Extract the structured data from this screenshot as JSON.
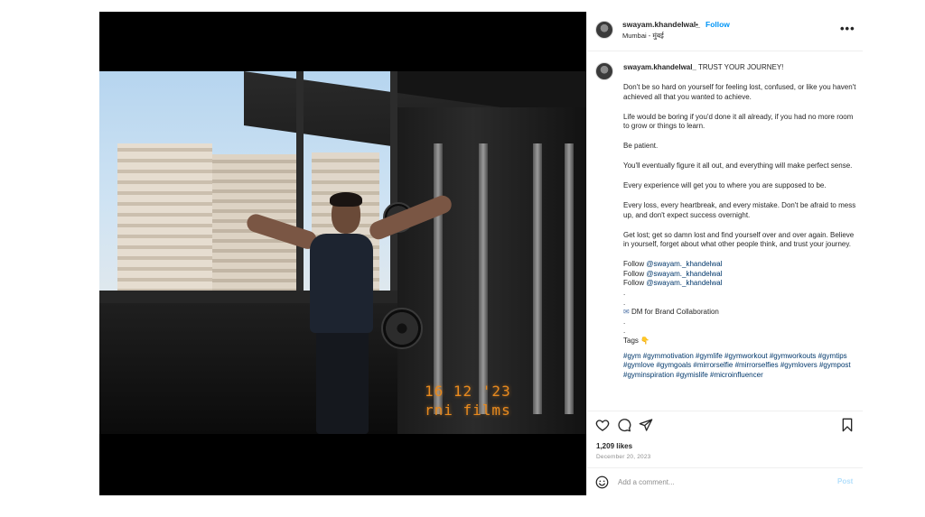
{
  "post": {
    "username": "swayam.khandelwal_",
    "separator": "•",
    "follow_label": "Follow",
    "location": "Mumbai - मुंबई",
    "more_label": "•••",
    "photo_stamp": {
      "line1": "16 12 '23",
      "line2": "rni films"
    }
  },
  "caption": {
    "username": "swayam.khandelwal_",
    "headline": "TRUST YOUR JOURNEY!",
    "paragraphs": [
      "Don't be so hard on yourself for feeling lost, confused, or like you haven't achieved all that you wanted to achieve.",
      "Life would be boring if you'd done it all already, if you had no more room to grow or things to learn.",
      "Be patient.",
      "You'll eventually figure it all out, and everything will make perfect sense.",
      "Every experience will get you to where you are supposed to be.",
      "Every loss, every heartbreak, and every mistake. Don't be afraid to mess up, and don't expect success overnight.",
      "Get lost; get so damn lost and find yourself over and over again. Believe in yourself, forget about what other people think, and trust your journey."
    ],
    "follow_lines": [
      {
        "prefix": "Follow ",
        "mention": "@swayam._khandelwal"
      },
      {
        "prefix": "Follow ",
        "mention": "@swayam._khandelwal"
      },
      {
        "prefix": "Follow ",
        "mention": "@swayam._khandelwal"
      }
    ],
    "dot": ".",
    "dm_line": "DM for Brand Collaboration",
    "dm_icon": "✉",
    "tags_label": "Tags 👇",
    "hashtags": "#gym #gymmotivation #gymlife #gymworkout #gymworkouts #gymtips #gymlove #gymgoals #mirrorselfie #mirrorselfies #gymlovers #gympost #gyminspiration #gymislife #microinfluencer"
  },
  "actions": {
    "like_icon": "heart-icon",
    "comment_icon": "comment-icon",
    "share_icon": "share-icon",
    "save_icon": "bookmark-icon",
    "likes": "1,209 likes",
    "date": "December 20, 2023"
  },
  "comment_box": {
    "placeholder": "Add a comment...",
    "post_label": "Post"
  },
  "colors": {
    "link": "#00376b",
    "follow": "#0095f6",
    "stamp": "#e98a1e"
  }
}
